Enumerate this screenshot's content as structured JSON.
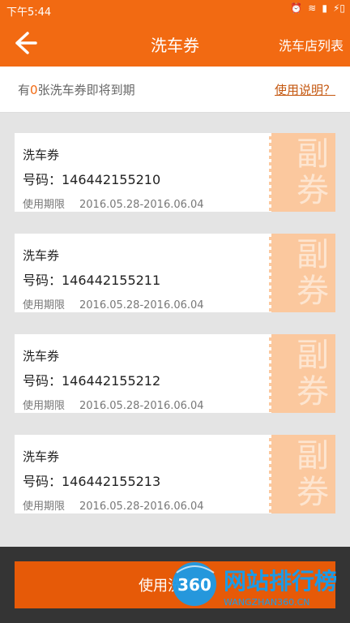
{
  "status_bar": {
    "time": "下午5:44"
  },
  "header": {
    "title": "洗车券",
    "right_link": "洗车店列表"
  },
  "notice": {
    "prefix": "有",
    "count": "0",
    "suffix": "张洗车券即将到期",
    "help_link": "使用说明？"
  },
  "coupons": [
    {
      "name": "洗车券",
      "code": "号码：146442155210",
      "period_label": "使用期限",
      "period": "2016.05.28-2016.06.04",
      "stub_text": "副券"
    },
    {
      "name": "洗车券",
      "code": "号码：146442155211",
      "period_label": "使用期限",
      "period": "2016.05.28-2016.06.04",
      "stub_text": "副券"
    },
    {
      "name": "洗车券",
      "code": "号码：146442155212",
      "period_label": "使用期限",
      "period": "2016.05.28-2016.06.04",
      "stub_text": "副券"
    },
    {
      "name": "洗车券",
      "code": "号码：146442155213",
      "period_label": "使用期限",
      "period": "2016.05.28-2016.06.04",
      "stub_text": "副券"
    }
  ],
  "action": {
    "use_button": "使用洗车券"
  },
  "watermark": {
    "logo": "360",
    "text": "网站排行榜",
    "subtext": "WANGZHAN360.CN"
  },
  "colors": {
    "brand": "#f26a12",
    "button": "#e65a08",
    "stub": "#fbc89e"
  }
}
